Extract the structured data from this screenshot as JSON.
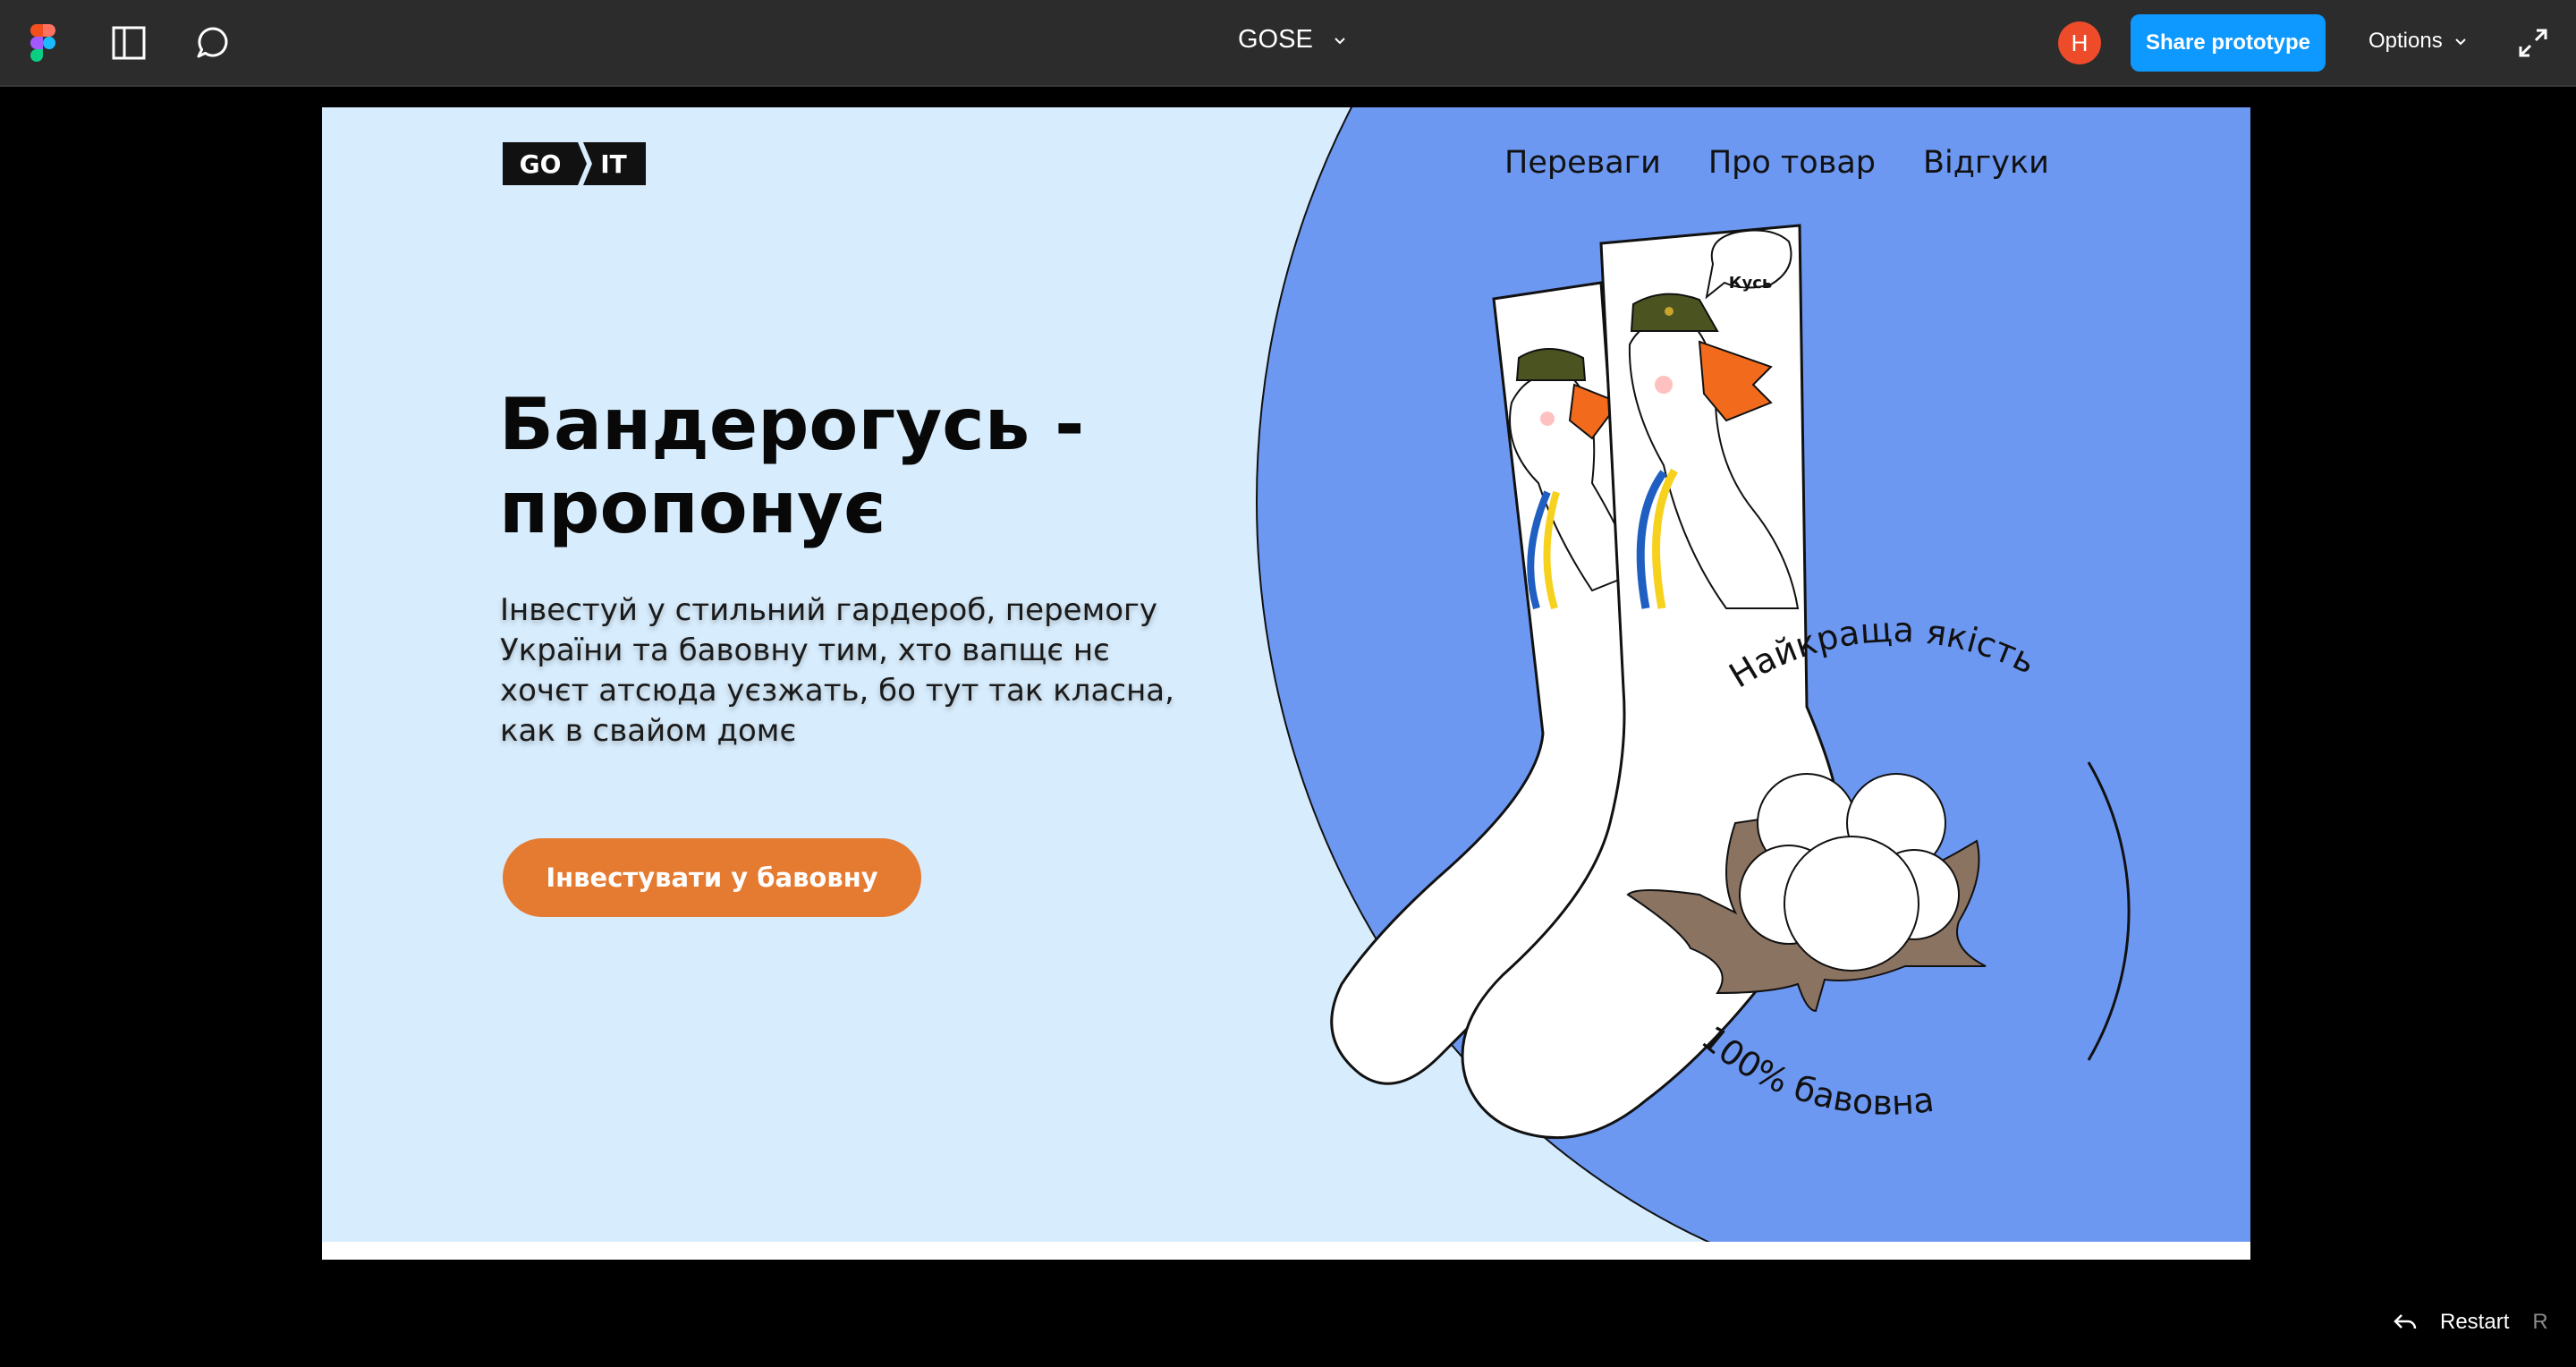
{
  "toolbar": {
    "document_title": "GOSE",
    "avatar_initial": "H",
    "share_label": "Share prototype",
    "options_label": "Options",
    "icons": [
      "figma-logo-icon",
      "sidebar-panel-icon",
      "comment-icon",
      "chevron-down-icon",
      "expand-icon"
    ]
  },
  "prototype": {
    "logo": {
      "left": "GO",
      "right": "IT"
    },
    "nav": [
      "Переваги",
      "Про товар",
      "Відгуки"
    ],
    "headline_line1": "Бандерогусь -",
    "headline_line2": "пропонує",
    "lead": "Інвестуй у стильний гардероб, перемогу України та бавовну тим, хто вапщє нє хочєт атсюда уєзжать, бо тут так класна, как в свайом домє",
    "cta_label": "Інвестувати у бавовну",
    "illustration": {
      "speech_bubble": "Кусь",
      "arc_top": "Найкраща якість",
      "arc_bottom": "100% бавовна"
    },
    "colors": {
      "background": "#d7ecfc",
      "circle": "#6d98f2",
      "cta": "#e57a31",
      "ukraine_blue": "#1f5fc2",
      "ukraine_yellow": "#f6d21e"
    }
  },
  "footer": {
    "restart_label": "Restart",
    "restart_key": "R",
    "restart_icon": "undo-arrow-icon"
  }
}
